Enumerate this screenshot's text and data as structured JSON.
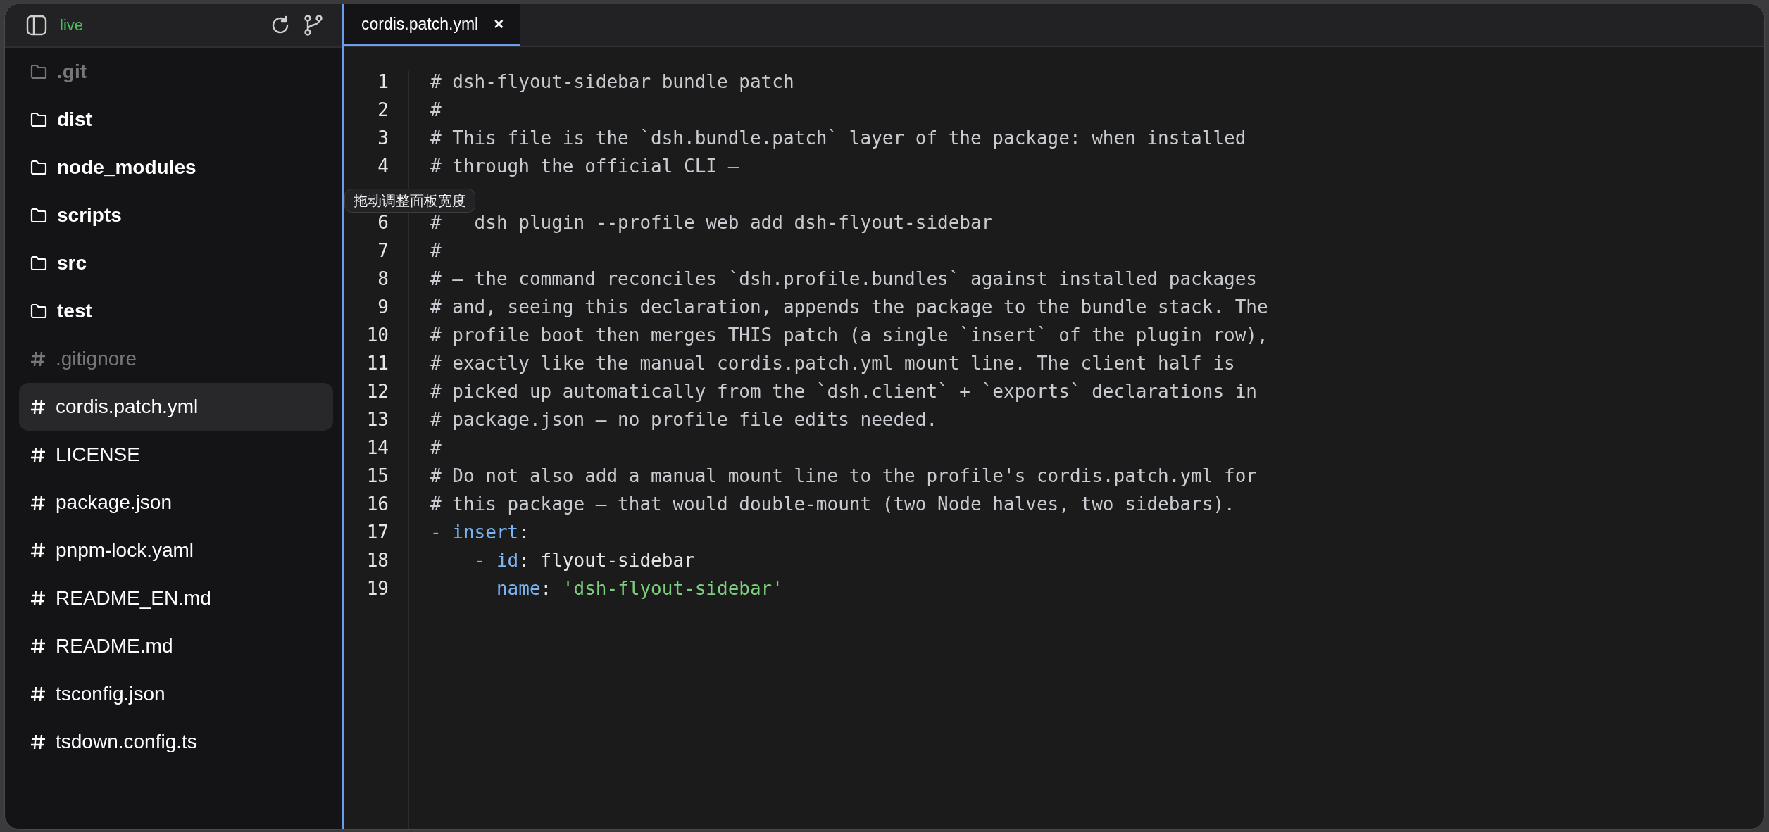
{
  "sidebar": {
    "header": {
      "status": "live"
    },
    "items": [
      {
        "kind": "folder",
        "name": ".git",
        "muted": true,
        "selected": false
      },
      {
        "kind": "folder",
        "name": "dist",
        "muted": false,
        "selected": false
      },
      {
        "kind": "folder",
        "name": "node_modules",
        "muted": false,
        "selected": false
      },
      {
        "kind": "folder",
        "name": "scripts",
        "muted": false,
        "selected": false
      },
      {
        "kind": "folder",
        "name": "src",
        "muted": false,
        "selected": false
      },
      {
        "kind": "folder",
        "name": "test",
        "muted": false,
        "selected": false
      },
      {
        "kind": "file",
        "name": ".gitignore",
        "muted": true,
        "selected": false
      },
      {
        "kind": "file",
        "name": "cordis.patch.yml",
        "muted": false,
        "selected": true
      },
      {
        "kind": "file",
        "name": "LICENSE",
        "muted": false,
        "selected": false
      },
      {
        "kind": "file",
        "name": "package.json",
        "muted": false,
        "selected": false
      },
      {
        "kind": "file",
        "name": "pnpm-lock.yaml",
        "muted": false,
        "selected": false
      },
      {
        "kind": "file",
        "name": "README_EN.md",
        "muted": false,
        "selected": false
      },
      {
        "kind": "file",
        "name": "README.md",
        "muted": false,
        "selected": false
      },
      {
        "kind": "file",
        "name": "tsconfig.json",
        "muted": false,
        "selected": false
      },
      {
        "kind": "file",
        "name": "tsdown.config.ts",
        "muted": false,
        "selected": false
      }
    ]
  },
  "tabs": [
    {
      "label": "cordis.patch.yml",
      "close": "×",
      "selected": true
    }
  ],
  "tooltip": "拖动调整面板宽度",
  "editor": {
    "lines": [
      {
        "number": "1",
        "tokens": [
          {
            "kind": "comment",
            "text": "# dsh-flyout-sidebar bundle patch"
          }
        ]
      },
      {
        "number": "2",
        "tokens": [
          {
            "kind": "comment",
            "text": "#"
          }
        ]
      },
      {
        "number": "3",
        "tokens": [
          {
            "kind": "comment",
            "text": "# This file is the `dsh.bundle.patch` layer of the package: when installed"
          }
        ]
      },
      {
        "number": "4",
        "tokens": [
          {
            "kind": "comment",
            "text": "# through the official CLI —"
          }
        ]
      },
      {
        "kind": "covered"
      },
      {
        "number": "6",
        "tokens": [
          {
            "kind": "comment",
            "text": "#   dsh plugin --profile web add dsh-flyout-sidebar"
          }
        ]
      },
      {
        "number": "7",
        "tokens": [
          {
            "kind": "comment",
            "text": "#"
          }
        ]
      },
      {
        "number": "8",
        "tokens": [
          {
            "kind": "comment",
            "text": "# — the command reconciles `dsh.profile.bundles` against installed packages"
          }
        ]
      },
      {
        "number": "9",
        "tokens": [
          {
            "kind": "comment",
            "text": "# and, seeing this declaration, appends the package to the bundle stack. The"
          }
        ]
      },
      {
        "number": "10",
        "tokens": [
          {
            "kind": "comment",
            "text": "# profile boot then merges THIS patch (a single `insert` of the plugin row),"
          }
        ]
      },
      {
        "number": "11",
        "tokens": [
          {
            "kind": "comment",
            "text": "# exactly like the manual cordis.patch.yml mount line. The client half is"
          }
        ]
      },
      {
        "number": "12",
        "tokens": [
          {
            "kind": "comment",
            "text": "# picked up automatically from the `dsh.client` + `exports` declarations in"
          }
        ]
      },
      {
        "number": "13",
        "tokens": [
          {
            "kind": "comment",
            "text": "# package.json — no profile file edits needed."
          }
        ]
      },
      {
        "number": "14",
        "tokens": [
          {
            "kind": "comment",
            "text": "#"
          }
        ]
      },
      {
        "number": "15",
        "tokens": [
          {
            "kind": "comment",
            "text": "# Do not also add a manual mount line to the profile's cordis.patch.yml for"
          }
        ]
      },
      {
        "number": "16",
        "tokens": [
          {
            "kind": "comment",
            "text": "# this package — that would double-mount (two Node halves, two sidebars)."
          }
        ]
      },
      {
        "number": "17",
        "tokens": [
          {
            "kind": "key",
            "text": "- insert"
          },
          {
            "kind": "plain",
            "text": ":"
          }
        ]
      },
      {
        "number": "18",
        "tokens": [
          {
            "kind": "key",
            "text": "    - id"
          },
          {
            "kind": "plain",
            "text": ": flyout-sidebar"
          }
        ]
      },
      {
        "number": "19",
        "tokens": [
          {
            "kind": "key",
            "text": "      name"
          },
          {
            "kind": "plain",
            "text": ": "
          },
          {
            "kind": "string",
            "text": "'dsh-flyout-sidebar'"
          }
        ]
      }
    ]
  }
}
